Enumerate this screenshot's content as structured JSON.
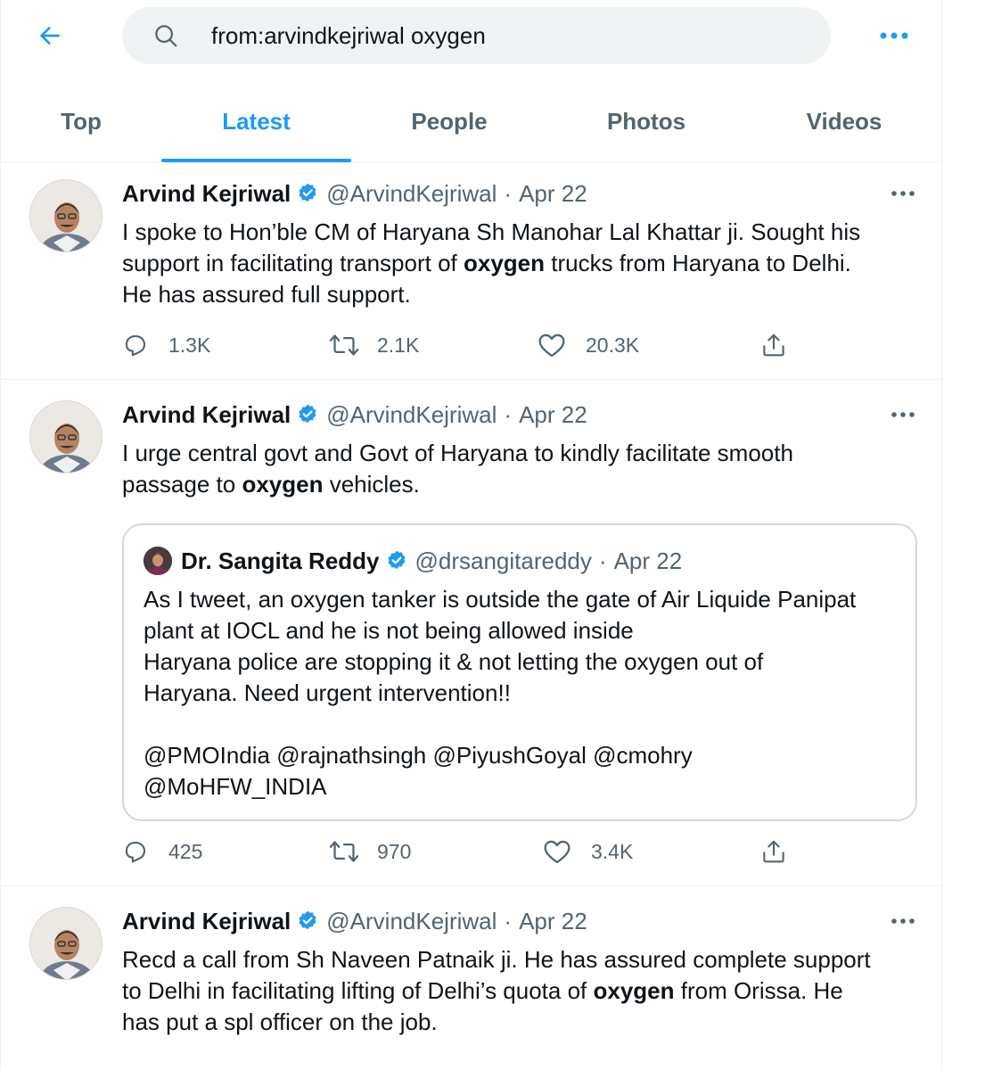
{
  "search": {
    "query": "from:arvindkejriwal oxygen"
  },
  "icons": {
    "back": "arrow-left-icon",
    "search": "search-icon",
    "more": "more-horizontal-icon",
    "verified": "verified-badge-icon",
    "reply": "reply-icon",
    "retweet": "retweet-icon",
    "like": "heart-icon",
    "share": "share-icon"
  },
  "colors": {
    "accent": "#1d9bf0",
    "text_secondary": "#536471",
    "search_bg": "#eff3f4"
  },
  "tabs": [
    {
      "label": "Top",
      "active": false
    },
    {
      "label": "Latest",
      "active": true
    },
    {
      "label": "People",
      "active": false
    },
    {
      "label": "Photos",
      "active": false
    },
    {
      "label": "Videos",
      "active": false
    }
  ],
  "tweets": [
    {
      "name": "Arvind Kejriwal",
      "handle": "@ArvindKejriwal",
      "separator": "·",
      "date": "Apr 22",
      "lines": [
        [
          "I spoke to Hon’ble CM of Haryana Sh Manohar Lal Khattar ji. Sought his",
          "",
          ""
        ],
        [
          "support in facilitating transport of ",
          "oxygen",
          " trucks from Haryana to Delhi."
        ],
        [
          "He has assured full support.",
          "",
          ""
        ]
      ],
      "replies": "1.3K",
      "retweets": "2.1K",
      "likes": "20.3K"
    },
    {
      "name": "Arvind Kejriwal",
      "handle": "@ArvindKejriwal",
      "separator": "·",
      "date": "Apr 22",
      "lines": [
        [
          "I urge central govt and Govt of Haryana to kindly facilitate smooth",
          "",
          ""
        ],
        [
          "passage to ",
          "oxygen",
          " vehicles."
        ]
      ],
      "quote": {
        "name": "Dr. Sangita Reddy",
        "handle": "@drsangitareddy",
        "separator": "·",
        "date": "Apr 22",
        "lines": [
          "As I tweet, an oxygen tanker is outside the gate of Air Liquide Panipat",
          "plant at IOCL and he is not being allowed inside",
          "Haryana police are stopping it & not letting the oxygen out of",
          "Haryana. Need urgent intervention!!",
          "",
          "@PMOIndia @rajnathsingh @PiyushGoyal @cmohry",
          "@MoHFW_INDIA"
        ]
      },
      "replies": "425",
      "retweets": "970",
      "likes": "3.4K"
    },
    {
      "name": "Arvind Kejriwal",
      "handle": "@ArvindKejriwal",
      "separator": "·",
      "date": "Apr 22",
      "lines": [
        [
          "Recd a call from Sh Naveen Patnaik ji. He has assured complete support",
          "",
          ""
        ],
        [
          "to Delhi in facilitating lifting of Delhi’s quota of ",
          "oxygen",
          " from Orissa. He"
        ],
        [
          "has put a spl officer on the job.",
          "",
          ""
        ]
      ]
    }
  ]
}
